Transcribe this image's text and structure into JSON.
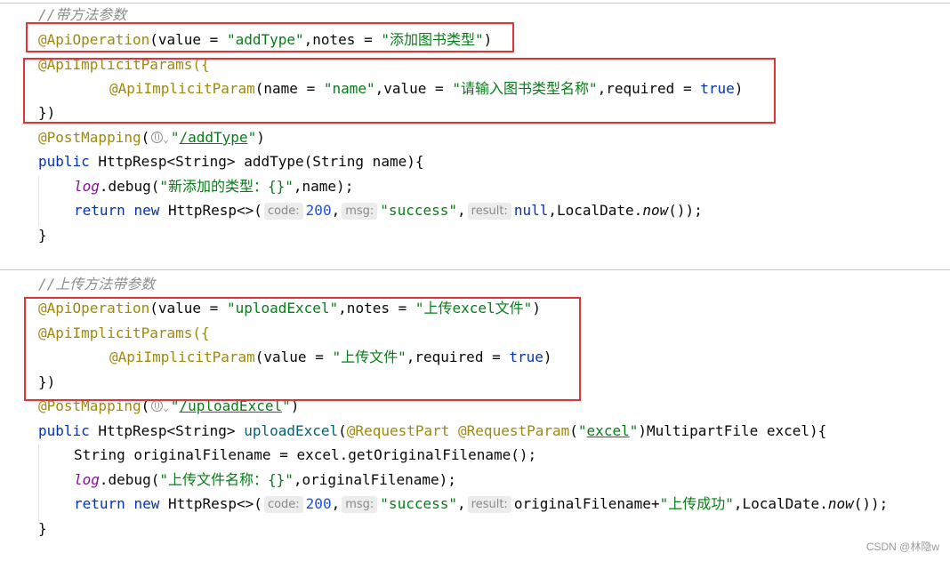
{
  "block1": {
    "comment": "//带方法参数",
    "api_operation": {
      "anno": "@ApiOperation",
      "open": "(value = ",
      "value": "\"addType\"",
      "mid": ",notes = ",
      "notes": "\"添加图书类型\"",
      "close": ")"
    },
    "implicit_params_open": "@ApiImplicitParams({",
    "implicit_param": {
      "anno": "@ApiImplicitParam",
      "open": "(name = ",
      "name": "\"name\"",
      "v1": ",value = ",
      "value": "\"请输入图书类型名称\"",
      "v2": ",required = ",
      "required": "true",
      "close": ")"
    },
    "implicit_params_close": "})",
    "post_mapping": {
      "anno": "@PostMapping",
      "open": "(",
      "q1": "\"",
      "path": "/addType",
      "q2": "\"",
      "close": ")"
    },
    "signature": {
      "kw": "public",
      "rest": " HttpResp<String> addType(String name){"
    },
    "log_line": {
      "field": "log",
      "call": ".debug(",
      "str": "\"新添加的类型：{}\"",
      "rest": ",name);"
    },
    "return_line": {
      "kw1": "return",
      "kw2": "new",
      "type": " HttpResp<>(",
      "hint_code": "code:",
      "code": "200",
      "comma1": ",",
      "hint_msg": "msg:",
      "msg": "\"success\"",
      "comma2": ",",
      "hint_result": "result:",
      "rest_a": "null,LocalDate.",
      "now": "now",
      "rest_b": "());"
    },
    "close_brace": "}"
  },
  "block2": {
    "comment": "//上传方法带参数",
    "api_operation": {
      "anno": "@ApiOperation",
      "open": "(value = ",
      "value": "\"uploadExcel\"",
      "mid": ",notes = ",
      "notes": "\"上传excel文件\"",
      "close": ")"
    },
    "implicit_params_open": "@ApiImplicitParams({",
    "implicit_param": {
      "anno": "@ApiImplicitParam",
      "open": "(value = ",
      "value": "\"上传文件\"",
      "v2": ",required = ",
      "required": "true",
      "close": ")"
    },
    "implicit_params_close": "})",
    "post_mapping": {
      "anno": "@PostMapping",
      "open": "(",
      "q1": "\"",
      "path": "/uploadExcel",
      "q2": "\"",
      "close": ")"
    },
    "signature": {
      "kw": "public",
      "a": " HttpResp<String> ",
      "method": "uploadExcel",
      "b": "(",
      "anno1": "@RequestPart",
      "sp": " ",
      "anno2": "@RequestParam",
      "c": "(",
      "q1": "\"",
      "param": "excel",
      "q2": "\"",
      "d": ")MultipartFile excel){"
    },
    "filename_line": "String originalFilename = excel.getOriginalFilename();",
    "log_line": {
      "field": "log",
      "call": ".debug(",
      "str": "\"上传文件名称：{}\"",
      "rest": ",originalFilename);"
    },
    "return_line": {
      "kw1": "return",
      "kw2": "new",
      "type": " HttpResp<>(",
      "hint_code": "code:",
      "code": "200",
      "comma1": ",",
      "hint_msg": "msg:",
      "msg": "\"success\"",
      "comma2": ",",
      "hint_result": "result:",
      "rest_a": "originalFilename+",
      "str2": "\"上传成功\"",
      "rest_b": ",LocalDate.",
      "now": "now",
      "rest_c": "());"
    },
    "close_brace": "}"
  },
  "watermark": "CSDN @林隐w",
  "colors": {
    "highlight_box": "#e03438",
    "annotation": "#9e880d",
    "string": "#067d17",
    "keyword": "#0033b3",
    "comment": "#8c8c8c"
  }
}
